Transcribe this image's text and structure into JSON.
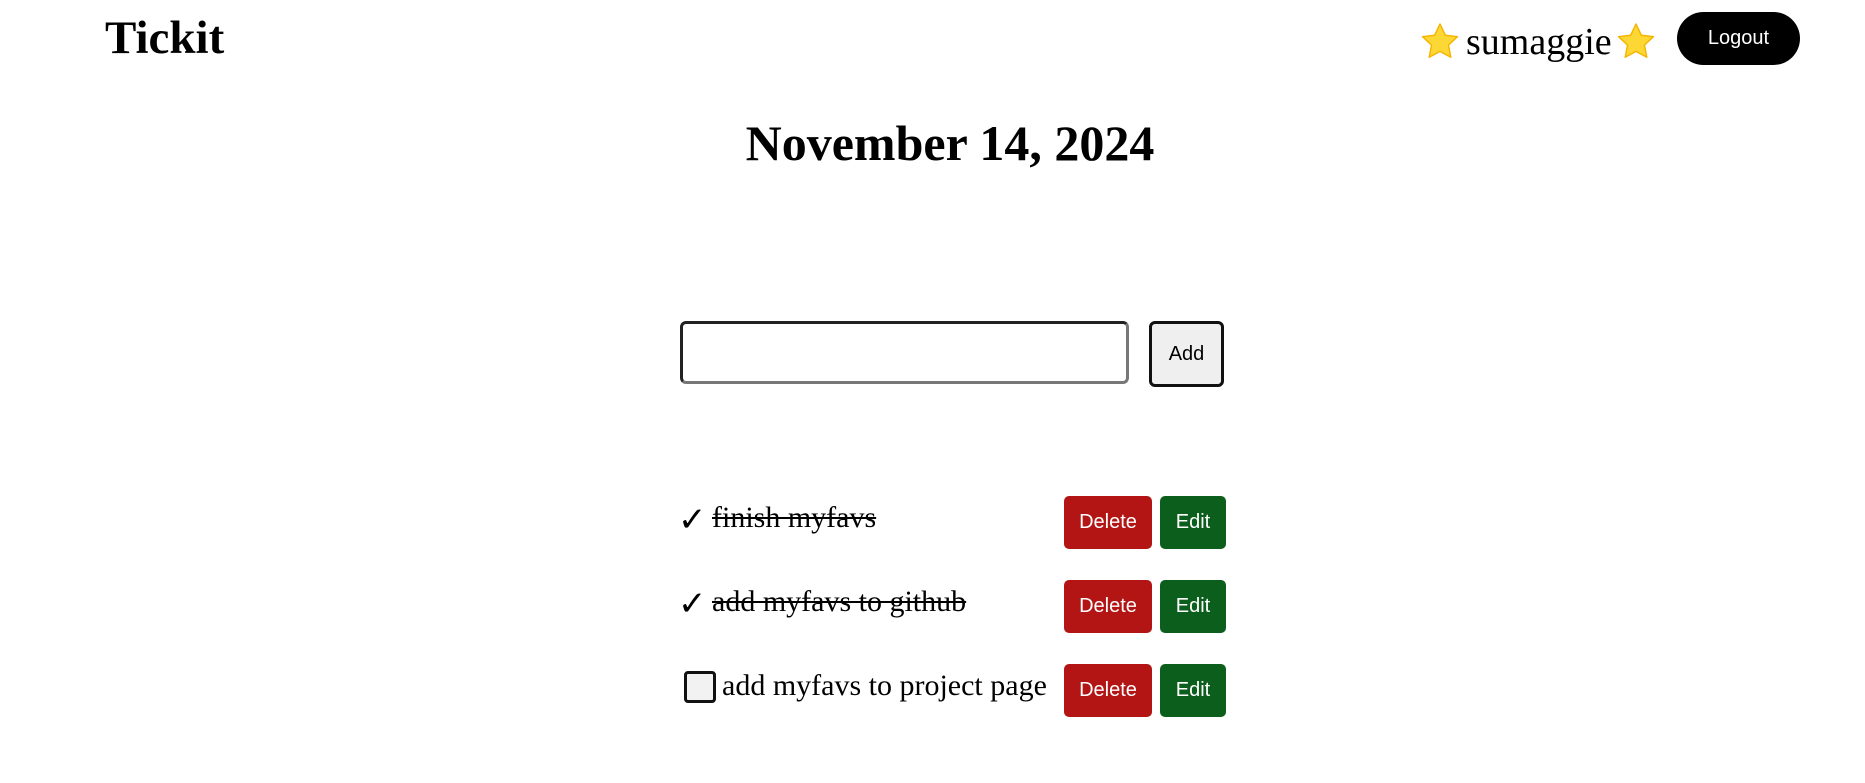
{
  "header": {
    "app_title": "Tickit",
    "username": "sumaggie",
    "logout_label": "Logout"
  },
  "main": {
    "date": "November 14, 2024",
    "input": {
      "value": "",
      "placeholder": ""
    },
    "add_label": "Add"
  },
  "tasks": [
    {
      "text": "finish myfavs",
      "done": true,
      "delete_label": "Delete",
      "edit_label": "Edit"
    },
    {
      "text": "add myfavs to github",
      "done": true,
      "delete_label": "Delete",
      "edit_label": "Edit"
    },
    {
      "text": "add myfavs to project page",
      "done": false,
      "delete_label": "Delete",
      "edit_label": "Edit"
    }
  ],
  "icons": {
    "star": "star-icon",
    "check": "checkmark-icon",
    "checkbox": "checkbox-icon"
  },
  "colors": {
    "delete": "#b31414",
    "edit": "#0b5e1b",
    "logout": "#000000",
    "star": "#fdd835"
  }
}
